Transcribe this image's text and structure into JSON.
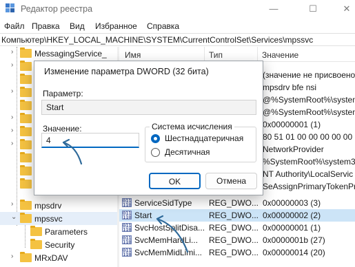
{
  "window": {
    "title": "Редактор реестра",
    "min_glyph": "—",
    "max_glyph": "☐",
    "close_glyph": "✕"
  },
  "menu": [
    "Файл",
    "Правка",
    "Вид",
    "Избранное",
    "Справка"
  ],
  "address": "Компьютер\\HKEY_LOCAL_MACHINE\\SYSTEM\\CurrentControlSet\\Services\\mpssvc",
  "tree": {
    "top_item": "MessagingService_",
    "partial_items": [
      "M",
      "M",
      "M",
      "M",
      "M",
      "M",
      "M"
    ],
    "items": {
      "mpsdrv": "mpsdrv",
      "mpssvc": "mpssvc",
      "parameters": "Parameters",
      "security": "Security",
      "mrxdav": "MRxDAV"
    }
  },
  "list": {
    "headers": {
      "name": "Имя",
      "type": "Тип",
      "value": "Значение"
    },
    "partial_values": [
      "Значение",
      "(значение не присвоено)",
      "mpsdrv bfe nsi",
      "@%SystemRoot%\\system",
      "@%SystemRoot%\\system",
      "0x00000001 (1)",
      "80 51 01 00 00 00 00 00",
      "NetworkProvider",
      "%SystemRoot%\\system32",
      "NT Authority\\LocalServic",
      "SeAssignPrimaryTokenPri"
    ],
    "rows": [
      {
        "name": "ServiceSidType",
        "type": "REG_DWO...",
        "value": "0x00000003 (3)"
      },
      {
        "name": "Start",
        "type": "REG_DWO...",
        "value": "0x00000002 (2)"
      },
      {
        "name": "SvcHostSplitDisa...",
        "type": "REG_DWO...",
        "value": "0x00000001 (1)"
      },
      {
        "name": "SvcMemHardLi...",
        "type": "REG_DWO...",
        "value": "0x0000001b (27)"
      },
      {
        "name": "SvcMemMidLimi...",
        "type": "REG_DWO...",
        "value": "0x00000014 (20)"
      }
    ],
    "icon_text": "011\n110"
  },
  "dialog": {
    "title": "Изменение параметра DWORD (32 бита)",
    "param_label": "Параметр:",
    "param_value": "Start",
    "value_label": "Значение:",
    "value_input": "4",
    "base_group": "Система исчисления",
    "radio_hex": "Шестнадцатеричная",
    "radio_dec": "Десятичная",
    "ok": "OK",
    "cancel": "Отмена"
  },
  "colors": {
    "accent": "#0067c0",
    "arrow": "#2f6a9a",
    "folder": "#f4c242"
  }
}
